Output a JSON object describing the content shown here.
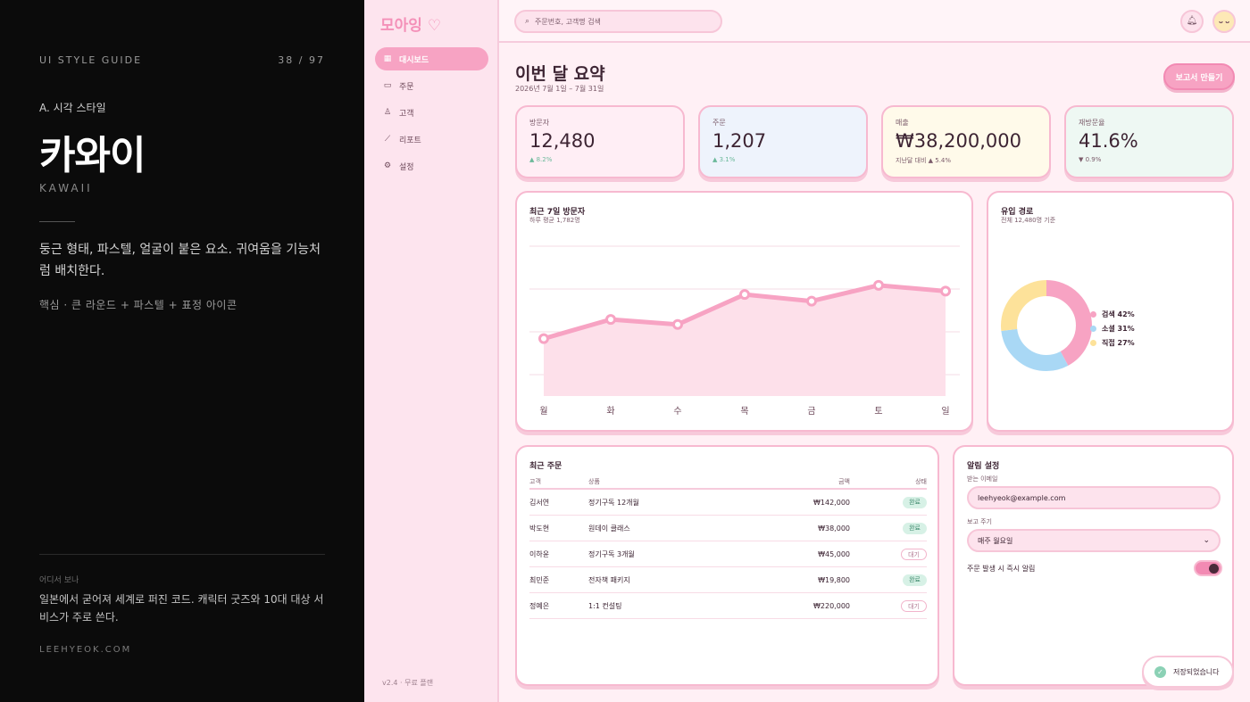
{
  "guide": {
    "header": "UI STYLE GUIDE",
    "page": "38 / 97",
    "section": "A. 시각 스타일",
    "title": "카와이",
    "subtitle": "KAWAII",
    "description": "둥근 형태, 파스텔, 얼굴이 붙은 요소. 귀여움을 기능처럼 배치한다.",
    "core": "핵심 · 큰 라운드 + 파스텔 + 표정 아이콘",
    "where_label": "어디서 보나",
    "where_text": "일본에서 굳어져 세계로 퍼진 코드. 캐릭터 굿즈와 10대 대상 서비스가 주로 쓴다.",
    "site": "LEEHYEOK.COM"
  },
  "app": {
    "logo": "모아잉 ♡",
    "nav": [
      {
        "label": "대시보드",
        "icon": "grid-icon"
      },
      {
        "label": "주문",
        "icon": "calendar-icon"
      },
      {
        "label": "고객",
        "icon": "user-icon"
      },
      {
        "label": "리포트",
        "icon": "chart-icon"
      },
      {
        "label": "설정",
        "icon": "settings-icon"
      }
    ],
    "version": "v2.4 · 무료 플랜",
    "search_placeholder": "주문번호, 고객명 검색",
    "avatar_face": "ᴗ ᴗ",
    "page_title": "이번 달 요약",
    "page_date": "2026년 7월 1일 – 7월 31일",
    "report_button": "보고서 만들기",
    "kpis": [
      {
        "label": "방문자",
        "value": "12,480",
        "delta": "▲ 8.2%",
        "bg": "#ffeef5"
      },
      {
        "label": "주문",
        "value": "1,207",
        "delta": "▲ 3.1%",
        "bg": "#eef3fc"
      },
      {
        "label": "매출",
        "value": "₩38,200,000",
        "delta": "지난달 대비 ▲ 5.4%",
        "bg": "#fffaea"
      },
      {
        "label": "재방문율",
        "value": "41.6%",
        "delta": "▼ 0.9%",
        "bg": "#eef8f3"
      }
    ],
    "visitors_title": "최근 7일 방문자",
    "visitors_sub": "하루 평균 1,782명",
    "source_title": "유입 경로",
    "source_sub": "전체 12,480명 기준",
    "orders_title": "최근 주문",
    "orders_headers": [
      "고객",
      "상품",
      "금액",
      "상태"
    ],
    "orders": [
      {
        "customer": "김서연",
        "product": "정기구독 12개월",
        "amount": "₩142,000",
        "status": "완료",
        "done": true
      },
      {
        "customer": "박도현",
        "product": "원데이 클래스",
        "amount": "₩38,000",
        "status": "완료",
        "done": true
      },
      {
        "customer": "이하윤",
        "product": "정기구독 3개월",
        "amount": "₩45,000",
        "status": "대기",
        "done": false
      },
      {
        "customer": "최민준",
        "product": "전자책 패키지",
        "amount": "₩19,800",
        "status": "완료",
        "done": true
      },
      {
        "customer": "정예은",
        "product": "1:1 컨설팅",
        "amount": "₩220,000",
        "status": "대기",
        "done": false
      }
    ],
    "settings_title": "알림 설정",
    "email_label": "받는 이메일",
    "email_value": "leehyeok@example.com",
    "cycle_label": "보고 주기",
    "cycle_value": "매주 월요일",
    "instant_label": "주문 발생 시 즉시 알림",
    "instant_on": true,
    "toast": "저장되었습니다"
  },
  "chart_data": [
    {
      "type": "area",
      "title": "최근 7일 방문자",
      "categories": [
        "월",
        "화",
        "수",
        "목",
        "금",
        "토",
        "일"
      ],
      "values": [
        1390,
        1620,
        1560,
        1920,
        1840,
        2030,
        1960
      ],
      "ylim": [
        700,
        2500
      ],
      "color": "#f7a3c3",
      "grid": true
    },
    {
      "type": "pie",
      "title": "유입 경로",
      "labels": [
        "검색",
        "소셜",
        "직접"
      ],
      "values": [
        42,
        31,
        27
      ],
      "legend": [
        "검색 42%",
        "소셜 31%",
        "직접 27%"
      ],
      "colors": [
        "#f7a3c3",
        "#a9d8f5",
        "#fde29a"
      ]
    }
  ]
}
